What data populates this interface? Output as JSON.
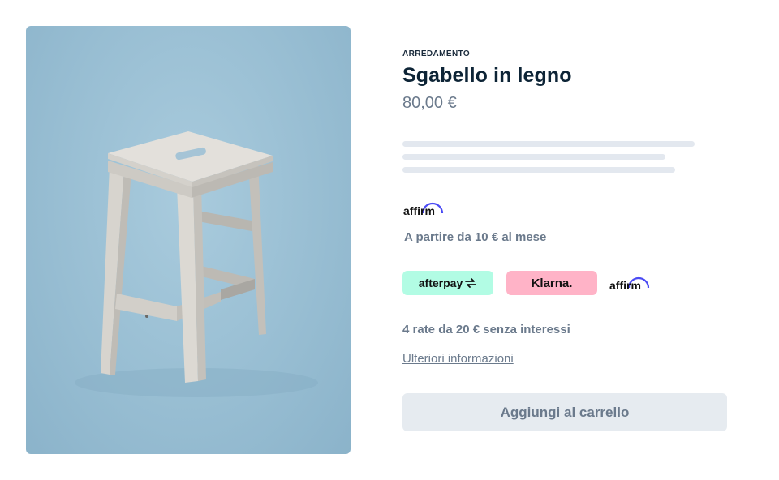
{
  "product": {
    "category": "ARREDAMENTO",
    "title": "Sgabello in legno",
    "price": "80,00 €"
  },
  "financing": {
    "affirm_logo": "affirm",
    "affirm_text": "A partire da 10 € al mese",
    "badges": {
      "afterpay": "afterpay",
      "klarna": "Klarna.",
      "affirm": "affirm"
    },
    "installments_text": "4 rate da 20 € senza interessi",
    "more_info_link": "Ulteriori informazioni"
  },
  "cart": {
    "add_button_label": "Aggiungi al carrello"
  },
  "colors": {
    "image_background": "#97bdd2",
    "afterpay_badge": "#b2fce4",
    "klarna_badge": "#ffb3c7",
    "affirm_arc": "#4a4af4",
    "button_background": "#e6ebf0",
    "muted_text": "#6b7a8c",
    "title_text": "#0d2436"
  }
}
